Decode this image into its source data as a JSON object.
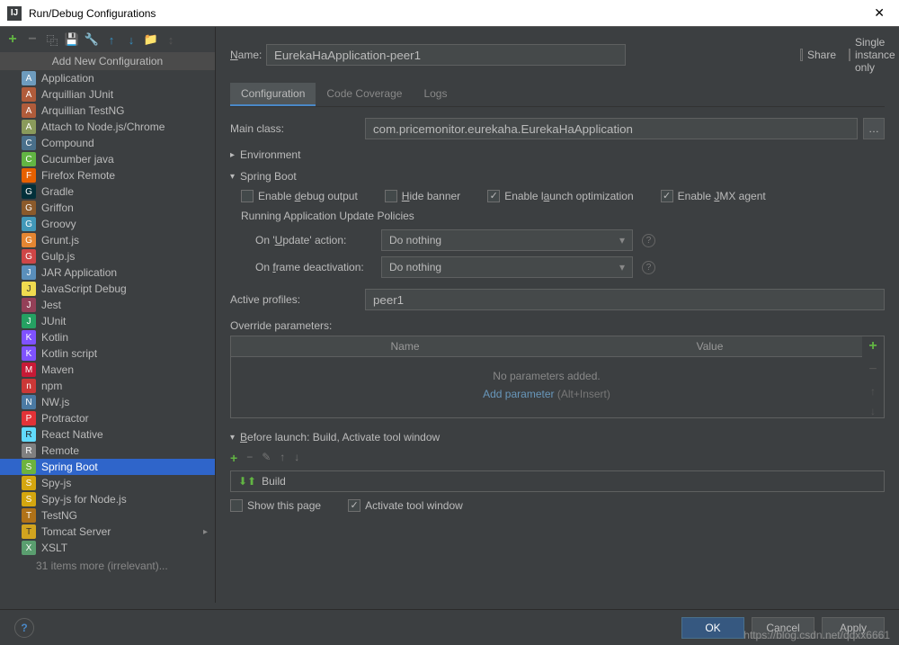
{
  "window": {
    "title": "Run/Debug Configurations",
    "close": "✕"
  },
  "popup": {
    "title": "Add New Configuration"
  },
  "configTypes": [
    {
      "label": "Application",
      "iconClass": "ic-app"
    },
    {
      "label": "Arquillian JUnit",
      "iconClass": "ic-arq"
    },
    {
      "label": "Arquillian TestNG",
      "iconClass": "ic-arq"
    },
    {
      "label": "Attach to Node.js/Chrome",
      "iconClass": "ic-attach"
    },
    {
      "label": "Compound",
      "iconClass": "ic-compound"
    },
    {
      "label": "Cucumber java",
      "iconClass": "ic-cucumber"
    },
    {
      "label": "Firefox Remote",
      "iconClass": "ic-firefox"
    },
    {
      "label": "Gradle",
      "iconClass": "ic-gradle"
    },
    {
      "label": "Griffon",
      "iconClass": "ic-griffon"
    },
    {
      "label": "Groovy",
      "iconClass": "ic-groovy"
    },
    {
      "label": "Grunt.js",
      "iconClass": "ic-grunt"
    },
    {
      "label": "Gulp.js",
      "iconClass": "ic-gulp"
    },
    {
      "label": "JAR Application",
      "iconClass": "ic-jar"
    },
    {
      "label": "JavaScript Debug",
      "iconClass": "ic-jsdebug"
    },
    {
      "label": "Jest",
      "iconClass": "ic-jest"
    },
    {
      "label": "JUnit",
      "iconClass": "ic-junit"
    },
    {
      "label": "Kotlin",
      "iconClass": "ic-kotlin"
    },
    {
      "label": "Kotlin script",
      "iconClass": "ic-kotlin"
    },
    {
      "label": "Maven",
      "iconClass": "ic-maven"
    },
    {
      "label": "npm",
      "iconClass": "ic-npm"
    },
    {
      "label": "NW.js",
      "iconClass": "ic-nw"
    },
    {
      "label": "Protractor",
      "iconClass": "ic-protractor"
    },
    {
      "label": "React Native",
      "iconClass": "ic-react"
    },
    {
      "label": "Remote",
      "iconClass": "ic-remote"
    },
    {
      "label": "Spring Boot",
      "iconClass": "ic-spring",
      "selected": true
    },
    {
      "label": "Spy-js",
      "iconClass": "ic-spy"
    },
    {
      "label": "Spy-js for Node.js",
      "iconClass": "ic-spy"
    },
    {
      "label": "TestNG",
      "iconClass": "ic-testng"
    },
    {
      "label": "Tomcat Server",
      "iconClass": "ic-tomcat",
      "hasSubmenu": true
    },
    {
      "label": "XSLT",
      "iconClass": "ic-xslt"
    }
  ],
  "moreItems": "31 items more (irrelevant)...",
  "form": {
    "nameLabel": "Name:",
    "nameValue": "EurekaHaApplication-peer1",
    "share": "Share",
    "singleInstance": "Single instance only",
    "tabs": {
      "config": "Configuration",
      "coverage": "Code Coverage",
      "logs": "Logs"
    },
    "mainClassLabel": "Main class:",
    "mainClassValue": "com.pricemonitor.eurekaha.EurekaHaApplication",
    "environment": "Environment",
    "springBoot": "Spring Boot",
    "enableDebug": "Enable debug output",
    "hideBanner": "Hide banner",
    "enableLaunchOpt": "Enable launch optimization",
    "enableJmx": "Enable JMX agent",
    "updatePoliciesTitle": "Running Application Update Policies",
    "onUpdateLabel": "On 'Update' action:",
    "onUpdateValue": "Do nothing",
    "onFrameLabel": "On frame deactivation:",
    "onFrameValue": "Do nothing",
    "activeProfilesLabel": "Active profiles:",
    "activeProfilesValue": "peer1",
    "overrideParamsLabel": "Override parameters:",
    "paramNameHeader": "Name",
    "paramValueHeader": "Value",
    "noParams": "No parameters added.",
    "addParamLink": "Add parameter",
    "addParamHint": " (Alt+Insert)",
    "beforeLaunchTitle": "Before launch: Build, Activate tool window",
    "buildTask": "Build",
    "showThisPage": "Show this page",
    "activateToolWindow": "Activate tool window"
  },
  "buttons": {
    "ok": "OK",
    "cancel": "Cancel",
    "apply": "Apply"
  },
  "watermark": "https://blog.csdn.net/qqxx6661"
}
